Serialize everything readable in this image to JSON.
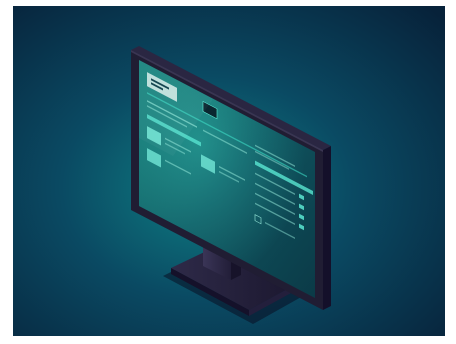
{
  "illustration": {
    "subject": "monitor-icon",
    "colors": {
      "bg_dark": "#07223a",
      "bg_glow": "#0f7f83",
      "screen_base": "#0d3f4a",
      "screen_glow": "#1fb8a8",
      "accent": "#3fe3cc",
      "bezel": "#201d33",
      "bezel_edge": "#3a3552",
      "stand": "#2a2540",
      "stand_shadow": "#130f22"
    }
  }
}
